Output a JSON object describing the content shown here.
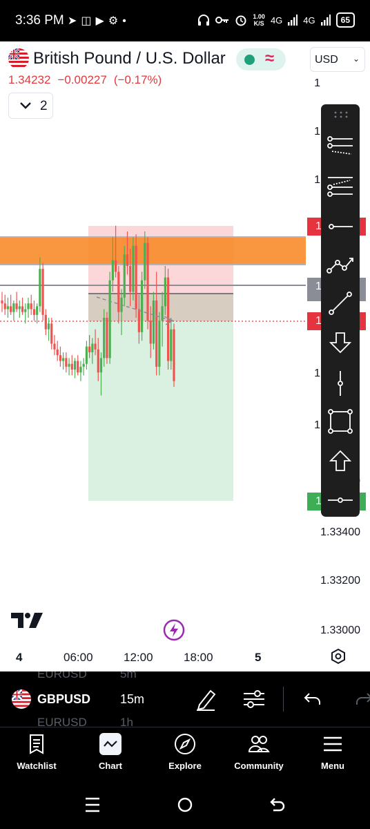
{
  "status_bar": {
    "time": "3:36 PM",
    "left_icons": [
      "telegram-icon",
      "gamepad-icon",
      "youtube-icon",
      "settings-dot-icon",
      "dot"
    ],
    "net_speed_value": "1.00",
    "net_speed_unit": "K/S",
    "network_1": "4G",
    "network_2": "4G",
    "battery": "65"
  },
  "header": {
    "symbol_title": "British Pound / U.S. Dollar",
    "currency": "USD",
    "last_price": "1.34232",
    "change": "−0.00227",
    "change_pct": "(−0.17%)",
    "indicator_count": "2",
    "colors": {
      "market_dot": "#20a07a",
      "change": "#e03a3e"
    }
  },
  "chart_data": {
    "type": "candlestick",
    "symbol": "GBPUSD",
    "interval": "15m",
    "y_axis": {
      "visible_labels": [
        "1.33600",
        "1.33400",
        "1.33200",
        "1.33000"
      ],
      "ylim": [
        1.3292,
        1.3508
      ]
    },
    "x_axis": {
      "labels": [
        {
          "text": "4",
          "bold": true
        },
        {
          "text": "06:00",
          "bold": false
        },
        {
          "text": "12:00",
          "bold": false
        },
        {
          "text": "18:00",
          "bold": false
        },
        {
          "text": "5",
          "bold": true
        }
      ]
    },
    "price_tags": [
      {
        "value": "1.33502",
        "color": "#3dae55"
      }
    ],
    "candles": [
      [
        1.3418,
        1.3421,
        1.3414,
        1.3417
      ],
      [
        1.3417,
        1.342,
        1.3413,
        1.3415
      ],
      [
        1.3415,
        1.3419,
        1.3412,
        1.3416
      ],
      [
        1.3416,
        1.342,
        1.3413,
        1.3414
      ],
      [
        1.3414,
        1.3418,
        1.3411,
        1.3417
      ],
      [
        1.3417,
        1.3421,
        1.3414,
        1.3415
      ],
      [
        1.3415,
        1.3418,
        1.3412,
        1.3416
      ],
      [
        1.3416,
        1.3419,
        1.3413,
        1.3414
      ],
      [
        1.3414,
        1.3417,
        1.341,
        1.3415
      ],
      [
        1.3415,
        1.3419,
        1.3412,
        1.3417
      ],
      [
        1.3417,
        1.342,
        1.3413,
        1.3415
      ],
      [
        1.3415,
        1.3418,
        1.3411,
        1.3413
      ],
      [
        1.3413,
        1.3417,
        1.341,
        1.3416
      ],
      [
        1.3416,
        1.3433,
        1.3414,
        1.3429
      ],
      [
        1.3429,
        1.3431,
        1.3411,
        1.3413
      ],
      [
        1.3413,
        1.3415,
        1.3406,
        1.3408
      ],
      [
        1.3408,
        1.3412,
        1.3404,
        1.341
      ],
      [
        1.341,
        1.3412,
        1.3401,
        1.3403
      ],
      [
        1.3403,
        1.3406,
        1.3399,
        1.3401
      ],
      [
        1.3401,
        1.3404,
        1.3397,
        1.3399
      ],
      [
        1.3399,
        1.3402,
        1.3395,
        1.3397
      ],
      [
        1.3397,
        1.34,
        1.3394,
        1.3398
      ],
      [
        1.3398,
        1.34,
        1.3393,
        1.3395
      ],
      [
        1.3395,
        1.3398,
        1.3392,
        1.3396
      ],
      [
        1.3396,
        1.3399,
        1.3392,
        1.3394
      ],
      [
        1.3394,
        1.3398,
        1.3391,
        1.3397
      ],
      [
        1.3397,
        1.3399,
        1.3392,
        1.3393
      ],
      [
        1.3393,
        1.3397,
        1.339,
        1.3395
      ],
      [
        1.3395,
        1.3398,
        1.3392,
        1.3396
      ],
      [
        1.3396,
        1.3404,
        1.3394,
        1.3402
      ],
      [
        1.3402,
        1.3406,
        1.3398,
        1.34
      ],
      [
        1.34,
        1.3405,
        1.3396,
        1.3403
      ],
      [
        1.3403,
        1.3408,
        1.3399,
        1.3401
      ],
      [
        1.3401,
        1.3405,
        1.339,
        1.3393
      ],
      [
        1.3393,
        1.34,
        1.3385,
        1.3398
      ],
      [
        1.3398,
        1.3415,
        1.3395,
        1.3412
      ],
      [
        1.3412,
        1.3414,
        1.3396,
        1.3398
      ],
      [
        1.3398,
        1.3428,
        1.3396,
        1.3425
      ],
      [
        1.3425,
        1.344,
        1.3421,
        1.3432
      ],
      [
        1.3432,
        1.3444,
        1.3426,
        1.3428
      ],
      [
        1.3428,
        1.343,
        1.341,
        1.3414
      ],
      [
        1.3414,
        1.3422,
        1.3406,
        1.3419
      ],
      [
        1.3419,
        1.3437,
        1.3416,
        1.3434
      ],
      [
        1.3434,
        1.3442,
        1.3427,
        1.343
      ],
      [
        1.343,
        1.3436,
        1.3416,
        1.3421
      ],
      [
        1.3421,
        1.344,
        1.3418,
        1.3437
      ],
      [
        1.3437,
        1.3441,
        1.3412,
        1.3415
      ],
      [
        1.3415,
        1.342,
        1.3403,
        1.3407
      ],
      [
        1.3407,
        1.3428,
        1.3404,
        1.3425
      ],
      [
        1.3425,
        1.3442,
        1.3422,
        1.3438
      ],
      [
        1.3438,
        1.344,
        1.3408,
        1.3411
      ],
      [
        1.3411,
        1.3416,
        1.3398,
        1.3403
      ],
      [
        1.3403,
        1.3421,
        1.3401,
        1.3418
      ],
      [
        1.3418,
        1.3428,
        1.3392,
        1.3395
      ],
      [
        1.3395,
        1.3414,
        1.3392,
        1.3411
      ],
      [
        1.3411,
        1.3421,
        1.3402,
        1.3416
      ],
      [
        1.3416,
        1.343,
        1.3413,
        1.3426
      ],
      [
        1.3426,
        1.3429,
        1.3394,
        1.3397
      ],
      [
        1.3397,
        1.3412,
        1.3394,
        1.3408
      ],
      [
        1.3408,
        1.341,
        1.3388,
        1.339
      ]
    ]
  },
  "drawing_toolbar": {
    "tools": [
      "fib-retracement-icon",
      "trend-fib-extension-icon",
      "horizontal-ray-icon",
      "path-icon",
      "trend-line-icon",
      "arrow-mark-down-icon",
      "vertical-line-icon",
      "rectangle-icon",
      "arrow-mark-up-icon",
      "horizontal-line-icon"
    ]
  },
  "symbol_bar": {
    "ghost_above": {
      "symbol": "EURUSD",
      "interval": "5m"
    },
    "symbol": "GBPUSD",
    "interval": "15m",
    "ghost_below": {
      "symbol": "EURUSD",
      "interval": "1h"
    }
  },
  "bottom_nav": {
    "items": [
      {
        "label": "Watchlist",
        "icon": "watchlist-icon"
      },
      {
        "label": "Chart",
        "icon": "chart-icon"
      },
      {
        "label": "Explore",
        "icon": "compass-icon"
      },
      {
        "label": "Community",
        "icon": "people-icon"
      },
      {
        "label": "Menu",
        "icon": "hamburger-icon"
      }
    ]
  }
}
